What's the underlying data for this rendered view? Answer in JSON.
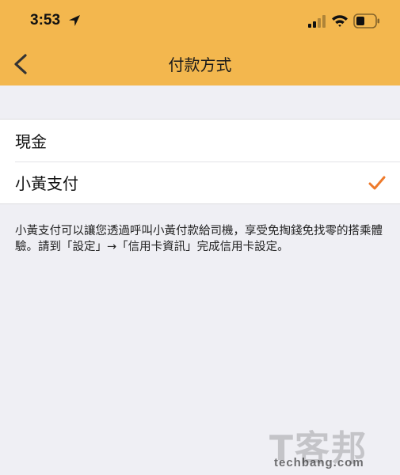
{
  "status_bar": {
    "time": "3:53"
  },
  "header": {
    "title": "付款方式",
    "back_icon": "chevron-left-icon",
    "background_color": "#f3b74e"
  },
  "payment_options": [
    {
      "label": "現金",
      "selected": false
    },
    {
      "label": "小黃支付",
      "selected": true
    }
  ],
  "check_color": "#ee7a2b",
  "note": "小黃支付可以讓您透過呼叫小黃付款給司機，享受免掏錢免找零的搭乘體驗。請到「設定」→「信用卡資訊」完成信用卡設定。",
  "watermark": {
    "main": "T客邦",
    "sub": "techbang.com"
  }
}
